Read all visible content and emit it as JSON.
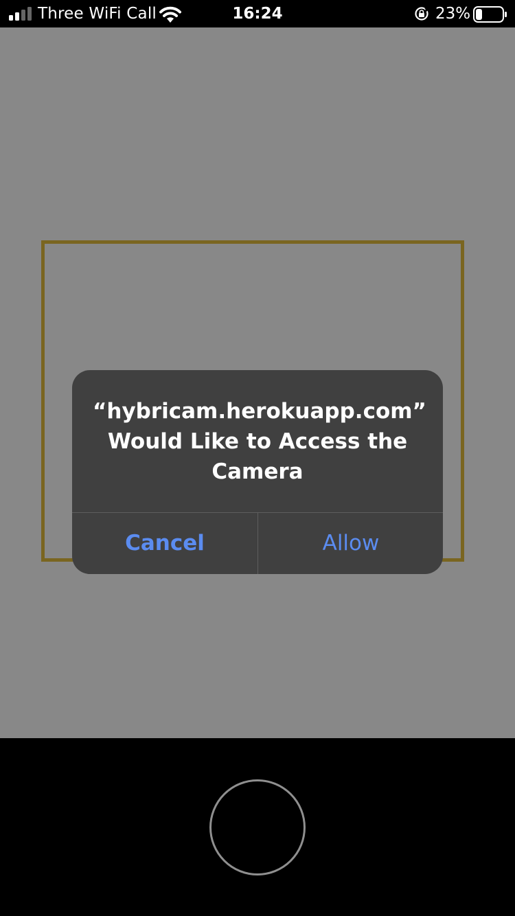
{
  "status_bar": {
    "carrier": "Three WiFi Call",
    "time": "16:24",
    "battery_percent": "23%",
    "battery_level": 0.23,
    "icons": [
      "signal-icon",
      "wifi-icon",
      "orientation-lock-icon",
      "battery-icon"
    ]
  },
  "alert": {
    "title_line1": "“hybricam.herokuapp.com”",
    "title_line2": "Would Like to Access the",
    "title_line3": "Camera",
    "cancel_label": "Cancel",
    "allow_label": "Allow"
  },
  "colors": {
    "camera_background": "#888888",
    "frame_border": "#7a6520",
    "alert_background": "#404040",
    "alert_button_text": "#5b8cf0"
  }
}
